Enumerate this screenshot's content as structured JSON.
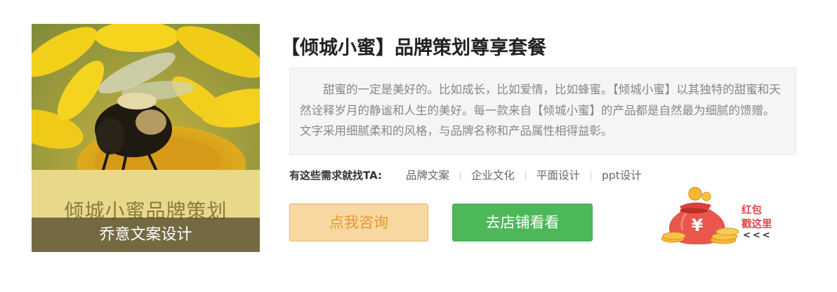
{
  "product": {
    "title": "【倾城小蜜】品牌策划尊享套餐",
    "thumbnail": {
      "banner_text": "倾城小蜜品牌策划",
      "caption": "乔意文案设计"
    },
    "description": "甜蜜的一定是美好的。比如成长，比如爱情，比如蜂蜜。【倾城小蜜】以其独特的甜蜜和天然诠释岁月的静谧和人生的美好。每一款来自【倾城小蜜】的产品都是自然最为细腻的馈赠。 文字采用细腻柔和的风格，与品牌名称和产品属性相得益彰。"
  },
  "needs": {
    "label": "有这些需求就找TA:",
    "tags": [
      "品牌文案",
      "企业文化",
      "平面设计",
      "ppt设计"
    ]
  },
  "buttons": {
    "consult": "点我咨询",
    "shop": "去店铺看看"
  },
  "red_packet": {
    "line1": "红包",
    "line2": "戳这里",
    "arrows": "<<<",
    "symbol": "¥",
    "icon": "red-envelope-money-bag-icon"
  },
  "colors": {
    "consult_bg": "#f9d7a1",
    "consult_text": "#e59a2b",
    "shop_bg": "#4cb85a",
    "red": "#e04848"
  }
}
